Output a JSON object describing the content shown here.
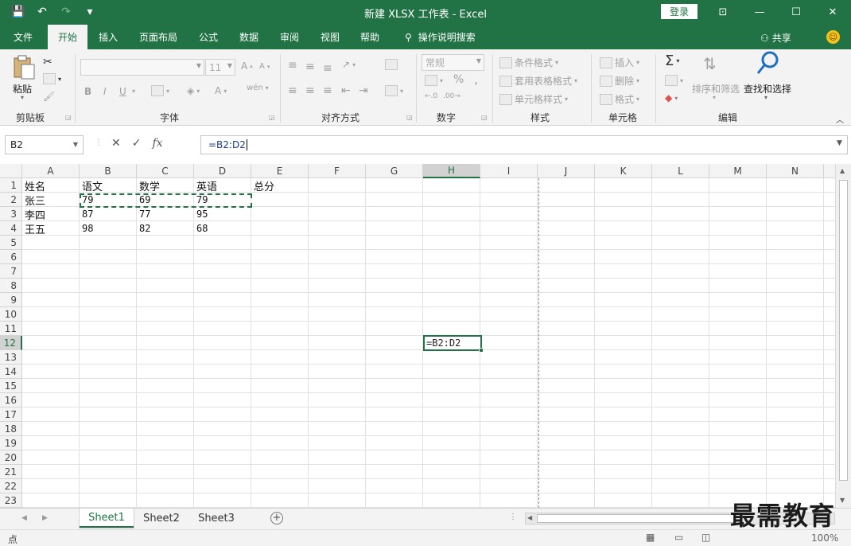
{
  "window": {
    "title": "新建 XLSX 工作表  -  Excel",
    "login_label": "登录",
    "controls": {
      "ribbon_display": "⊡",
      "minimize": "—",
      "maximize": "☐",
      "close": "✕"
    }
  },
  "qat": {
    "save": "💾",
    "undo": "↶",
    "redo": "↷",
    "customize": "▾"
  },
  "tabs": [
    "文件",
    "开始",
    "插入",
    "页面布局",
    "公式",
    "数据",
    "审阅",
    "视图",
    "帮助",
    "操作说明搜索"
  ],
  "active_tab": "开始",
  "share_label": "共享",
  "ribbon": {
    "clipboard": {
      "paste_label": "粘贴",
      "group_label": "剪贴板"
    },
    "font": {
      "font_name": "",
      "font_size": "11",
      "bold": "B",
      "italic": "I",
      "underline": "U",
      "group_label": "字体"
    },
    "alignment": {
      "group_label": "对齐方式"
    },
    "number": {
      "format": "常规",
      "percent": "%",
      "comma": ",",
      "group_label": "数字"
    },
    "styles": {
      "conditional": "条件格式",
      "table": "套用表格格式",
      "cell": "单元格样式",
      "group_label": "样式"
    },
    "cells": {
      "insert": "插入",
      "delete": "删除",
      "format": "格式",
      "group_label": "单元格"
    },
    "editing": {
      "sort_filter": "排序和筛选",
      "find_select": "查找和选择",
      "group_label": "编辑"
    }
  },
  "formula_bar": {
    "name_box": "B2",
    "formula": "=B2:D2",
    "cancel": "✕",
    "enter": "✓",
    "fx": "fx"
  },
  "grid": {
    "columns": [
      "A",
      "B",
      "C",
      "D",
      "E",
      "F",
      "G",
      "H",
      "I",
      "J",
      "K",
      "L",
      "M",
      "N"
    ],
    "rows": [
      "1",
      "2",
      "3",
      "4",
      "5",
      "6",
      "7",
      "8",
      "9",
      "10",
      "11",
      "12",
      "13",
      "14",
      "15",
      "16",
      "17",
      "18",
      "19",
      "20",
      "21",
      "22",
      "23"
    ],
    "selected_column": "H",
    "selected_row": "12",
    "cells": {
      "A1": "姓名",
      "B1": "语文",
      "C1": "数学",
      "D1": "英语",
      "E1": "总分",
      "A2": "张三",
      "B2": "79",
      "C2": "69",
      "D2": "79",
      "A3": "李四",
      "B3": "87",
      "C3": "77",
      "D3": "95",
      "A4": "王五",
      "B4": "98",
      "C4": "82",
      "D4": "68"
    },
    "active_cell_text": "=B2:D2"
  },
  "sheets": [
    "Sheet1",
    "Sheet2",
    "Sheet3"
  ],
  "active_sheet": "Sheet1",
  "status": {
    "mode": "点",
    "zoom": "100%"
  },
  "watermark": "最需教育"
}
